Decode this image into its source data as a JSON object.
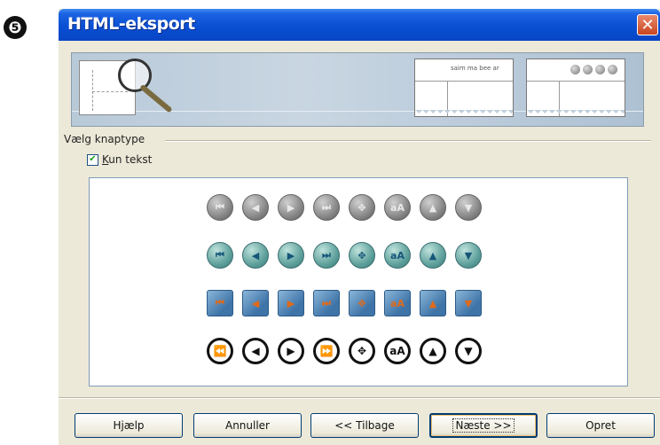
{
  "step_badge": "❺",
  "window": {
    "title": "HTML-eksport",
    "close_glyph": "✕"
  },
  "banner": {
    "paper_text": "saim ma bee ar"
  },
  "group": {
    "label": "Vælg knaptype"
  },
  "checkbox": {
    "checked": true,
    "check_glyph": "✔",
    "label_mnemonic": "K",
    "label_rest": "un tekst"
  },
  "icon_rows": [
    {
      "style": "gray",
      "icons": [
        {
          "name": "first-icon",
          "glyph": "⏮"
        },
        {
          "name": "previous-icon",
          "glyph": "◀"
        },
        {
          "name": "next-icon",
          "glyph": "▶"
        },
        {
          "name": "last-icon",
          "glyph": "⏭"
        },
        {
          "name": "navigate-icon",
          "glyph": "✥"
        },
        {
          "name": "text-icon",
          "glyph": "aA"
        },
        {
          "name": "up-icon",
          "glyph": "▲"
        },
        {
          "name": "down-icon",
          "glyph": "▼"
        }
      ]
    },
    {
      "style": "teal",
      "icons": [
        {
          "name": "first-icon",
          "glyph": "⏮"
        },
        {
          "name": "previous-icon",
          "glyph": "◀"
        },
        {
          "name": "next-icon",
          "glyph": "▶"
        },
        {
          "name": "last-icon",
          "glyph": "⏭"
        },
        {
          "name": "navigate-icon",
          "glyph": "✥"
        },
        {
          "name": "text-icon",
          "glyph": "aA"
        },
        {
          "name": "up-icon",
          "glyph": "▲"
        },
        {
          "name": "down-icon",
          "glyph": "▼"
        }
      ]
    },
    {
      "style": "blue",
      "icons": [
        {
          "name": "first-icon",
          "glyph": "⏮"
        },
        {
          "name": "previous-icon",
          "glyph": "◀"
        },
        {
          "name": "next-icon",
          "glyph": "▶"
        },
        {
          "name": "last-icon",
          "glyph": "⏭"
        },
        {
          "name": "navigate-icon",
          "glyph": "✥"
        },
        {
          "name": "text-icon",
          "glyph": "aA"
        },
        {
          "name": "up-icon",
          "glyph": "▲"
        },
        {
          "name": "down-icon",
          "glyph": "▼"
        }
      ]
    },
    {
      "style": "mono",
      "icons": [
        {
          "name": "first-icon",
          "glyph": "⏪"
        },
        {
          "name": "previous-icon",
          "glyph": "◀"
        },
        {
          "name": "next-icon",
          "glyph": "▶"
        },
        {
          "name": "last-icon",
          "glyph": "⏩"
        },
        {
          "name": "navigate-icon",
          "glyph": "✥"
        },
        {
          "name": "text-icon",
          "glyph": "aA"
        },
        {
          "name": "up-icon",
          "glyph": "▲"
        },
        {
          "name": "down-icon",
          "glyph": "▼"
        }
      ]
    }
  ],
  "buttons": {
    "help": "Hjælp",
    "cancel": "Annuller",
    "back": "<< Tilbage",
    "next": "Næste >>",
    "create": "Opret"
  },
  "colors": {
    "titlebar": "#0a4fd4",
    "dialog_bg": "#ece9d8",
    "close_button": "#c8451f"
  }
}
